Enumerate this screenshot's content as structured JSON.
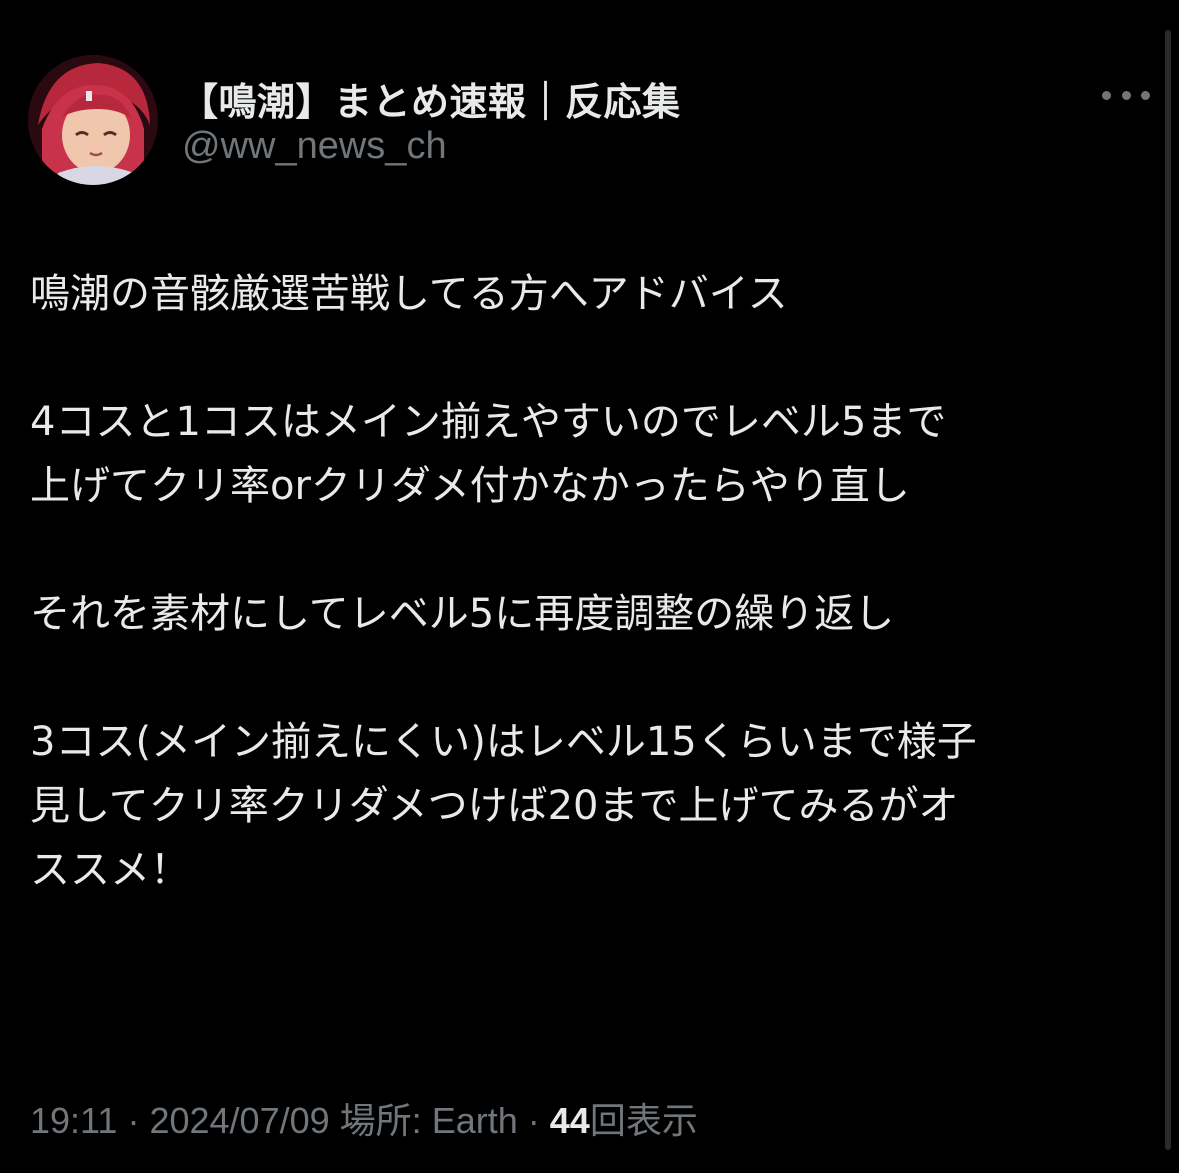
{
  "author": {
    "display_name": "【鳴潮】まとめ速報｜反応集",
    "handle": "@ww_news_ch",
    "avatar_icon": "avatar-anime-character-icon"
  },
  "more_icon": "more-horizontal-icon",
  "tweet": {
    "paragraphs": [
      [
        "鳴潮の音骸厳選苦戦してる方へアドバイス"
      ],
      [
        "4コスと1コスはメイン揃えやすいのでレベル5まで",
        "上げてクリ率orクリダメ付かなかったらやり直し"
      ],
      [
        "それを素材にしてレベル5に再度調整の繰り返し"
      ],
      [
        "3コス(メイン揃えにくい)はレベル15くらいまで様子",
        "見してクリ率クリダメつけば20まで上げてみるがオ",
        "ススメ！"
      ]
    ]
  },
  "meta": {
    "time": "19:11",
    "separator": "·",
    "date": "2024/07/09",
    "location_label": "場所:",
    "location": "Earth",
    "views_count": "44",
    "views_label": "回表示"
  },
  "colors": {
    "background": "#000000",
    "text": "#e7e9ea",
    "secondary": "#71767b"
  }
}
